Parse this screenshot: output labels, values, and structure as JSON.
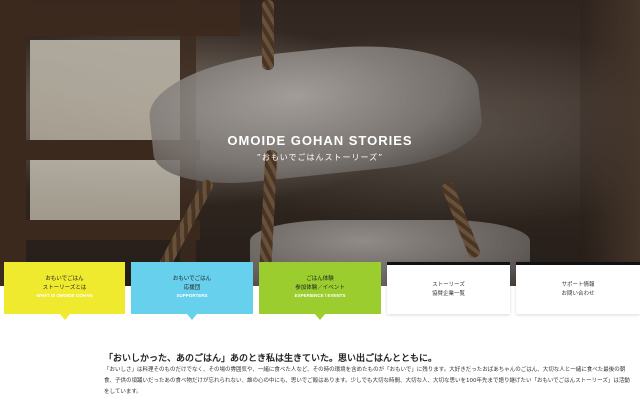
{
  "hero": {
    "title": "OMOIDE GOHAN STORIES",
    "subtitle": "”おもいでごはんストーリーズ”"
  },
  "nav": {
    "tiles": [
      {
        "jp_line1": "おもいでごはん",
        "jp_line2": "ストーリーズとは",
        "en": "WHAT IS OMOIDE GOHAN",
        "color": "#f0ea2e"
      },
      {
        "jp_line1": "おもいでごはん",
        "jp_line2": "応援団",
        "en": "SUPPORTERS",
        "color": "#67d0ec"
      },
      {
        "jp_line1": "ごはん体験",
        "jp_line2": "参加体験／イベント",
        "en": "EXPERIENCE / EVENTS",
        "color": "#9acd2d"
      },
      {
        "jp_line1": "ストーリーズ",
        "jp_line2": "協賛企業一覧",
        "en": "",
        "color": "#ffffff"
      },
      {
        "jp_line1": "サポート情報",
        "jp_line2": "お問い合わせ",
        "en": "",
        "color": "#ffffff"
      }
    ]
  },
  "intro": {
    "lead": "「おいしかった、あのごはん」あのとき私は生きていた。思い出ごはんとともに。",
    "body": "「おいしさ」は料理そのものだけでなく、その場の雰囲気や、一緒に食べた人など、その時の環境を含めたものが「おもいで」に残ります。大好きだったおばあちゃんのごはん、大切な人と一緒に食べた最後の朝食、子供の頃踊いだったあの食べ物だけが忘れられない、誰の心の中にも、思いでご飯はあります。少しでも大切な時間、大切な人、大切な思いを100年先まで語り継げたい「おもいでごはんストーリーズ」は活動をしています。"
  }
}
